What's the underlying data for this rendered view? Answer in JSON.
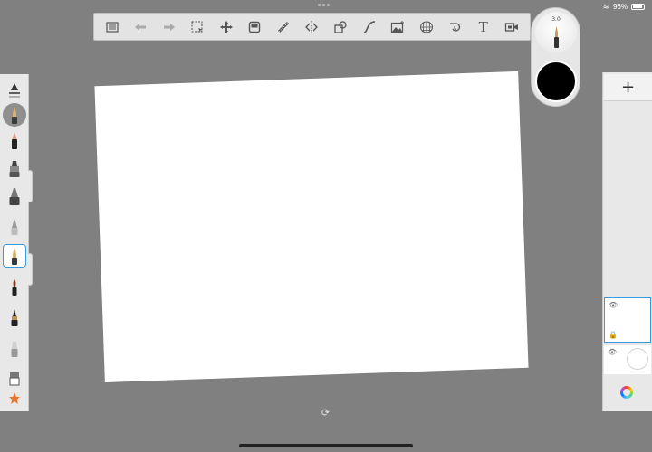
{
  "status": {
    "battery": "96%"
  },
  "toolbar": {
    "items": [
      {
        "name": "menu-list-icon",
        "glyph": "≣"
      },
      {
        "name": "undo-icon",
        "glyph": "⬅"
      },
      {
        "name": "redo-icon",
        "glyph": "➡"
      },
      {
        "name": "selection-icon",
        "glyph": "⬚"
      },
      {
        "name": "transform-icon",
        "glyph": "✥"
      },
      {
        "name": "layer-editor-icon",
        "glyph": "▣"
      },
      {
        "name": "ruler-icon",
        "glyph": "⟋"
      },
      {
        "name": "symmetry-icon",
        "glyph": "⇹"
      },
      {
        "name": "shapes-icon",
        "glyph": "⧉"
      },
      {
        "name": "curve-icon",
        "glyph": "∫"
      },
      {
        "name": "import-image-icon",
        "glyph": "🖾"
      },
      {
        "name": "perspective-grid-icon",
        "glyph": "⊞"
      },
      {
        "name": "time-lapse-icon",
        "glyph": "⟲"
      },
      {
        "name": "text-icon",
        "glyph": "T"
      },
      {
        "name": "record-video-icon",
        "glyph": "▶"
      }
    ]
  },
  "brush_puck": {
    "size_label": "3.0",
    "color": "#000000"
  },
  "left_palette": {
    "tools": [
      "brush-size-slider-icon",
      "selected-brush-size-icon",
      "pencil-icon",
      "marker-icon",
      "chisel-marker-icon",
      "airbrush-icon",
      "ballpoint-pen-icon",
      "paintbrush-icon",
      "ink-pen-icon",
      "soft-eraser-icon",
      "hard-eraser-icon",
      "favorites-star-icon"
    ]
  },
  "right_panel": {
    "add_label": "+"
  },
  "colors": {
    "accent": "#3a9ad9",
    "background": "#808080",
    "panel": "#e8e8e8"
  }
}
